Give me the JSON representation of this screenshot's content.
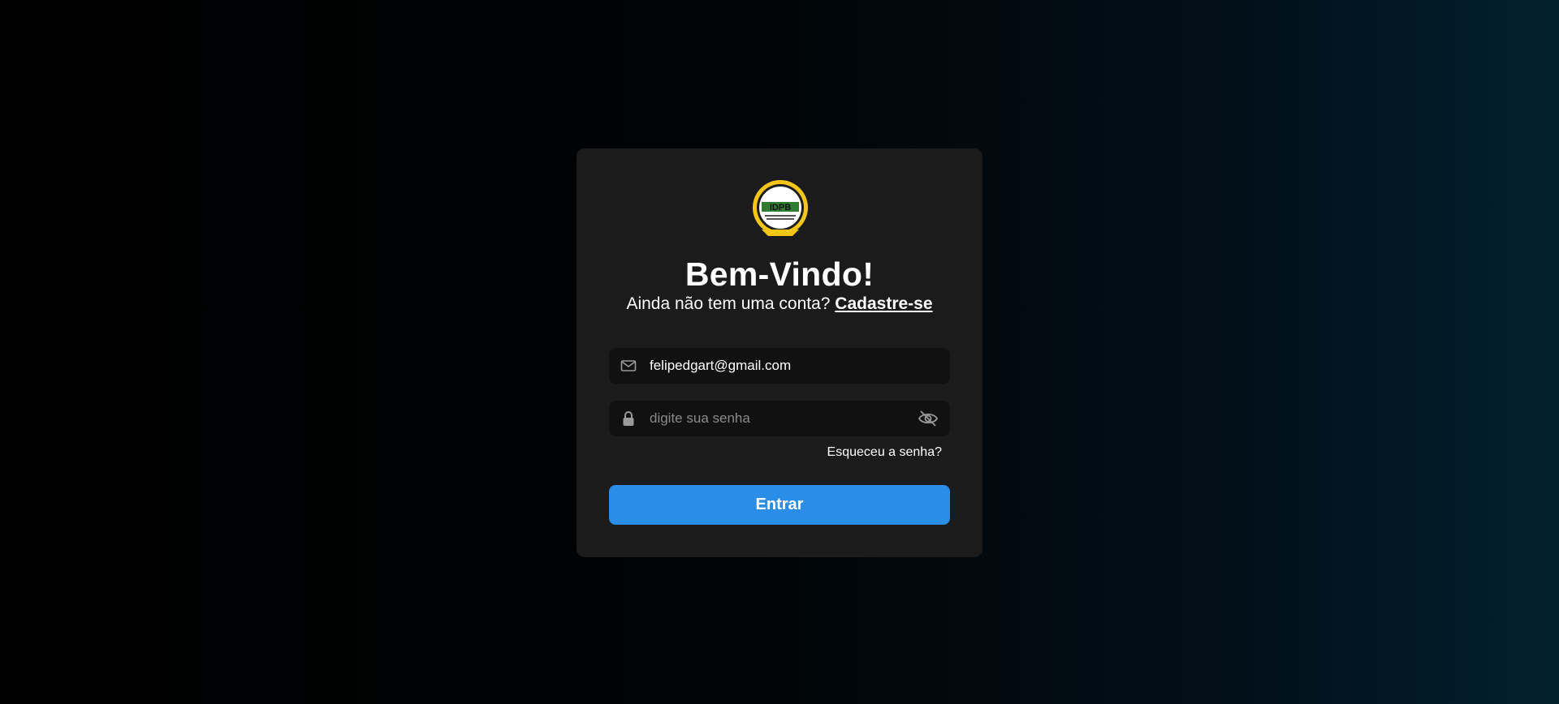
{
  "login": {
    "logo_text": "IDPB",
    "title": "Bem-Vindo!",
    "subtitle_text": "Ainda não tem uma conta?",
    "signup_link": "Cadastre-se",
    "email_value": "felipedgart@gmail.com",
    "password_placeholder": "digite sua senha",
    "forgot_password": "Esqueceu a senha?",
    "submit_label": "Entrar"
  },
  "icons": {
    "email": "envelope-icon",
    "password": "lock-icon",
    "toggle": "eye-slash-icon"
  },
  "colors": {
    "card_background": "#1b1b1b",
    "input_background": "#111111",
    "button": "#2a8ee8",
    "logo_gold": "#f5c518"
  }
}
